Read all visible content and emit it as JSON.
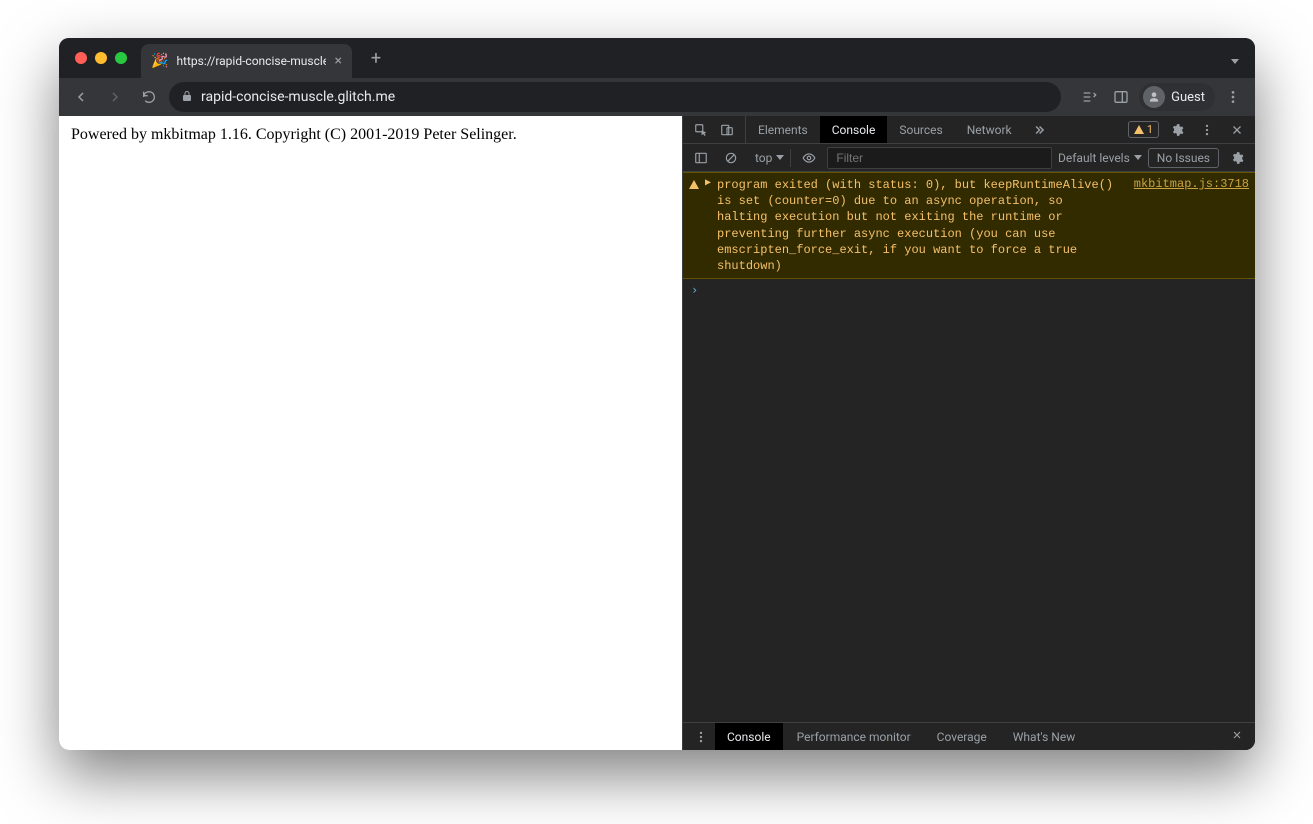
{
  "tab": {
    "title": "https://rapid-concise-muscle.g",
    "favicon": "🎉"
  },
  "omnibox": {
    "url": "rapid-concise-muscle.glitch.me"
  },
  "profile": {
    "label": "Guest"
  },
  "page": {
    "body_text": "Powered by mkbitmap 1.16. Copyright (C) 2001-2019 Peter Selinger."
  },
  "devtools": {
    "tabs": {
      "elements": "Elements",
      "console": "Console",
      "sources": "Sources",
      "network": "Network"
    },
    "warning_count": "1",
    "console_toolbar": {
      "context": "top",
      "filter_placeholder": "Filter",
      "levels_label": "Default levels",
      "no_issues": "No Issues"
    },
    "logs": [
      {
        "level": "warning",
        "message": "program exited (with status: 0), but keepRuntimeAlive() is set (counter=0) due to an async operation, so halting execution but not exiting the runtime or preventing further async execution (you can use emscripten_force_exit, if you want to force a true shutdown)",
        "source": "mkbitmap.js:3718"
      }
    ],
    "drawer": {
      "console": "Console",
      "perf": "Performance monitor",
      "coverage": "Coverage",
      "whatsnew": "What's New"
    }
  }
}
